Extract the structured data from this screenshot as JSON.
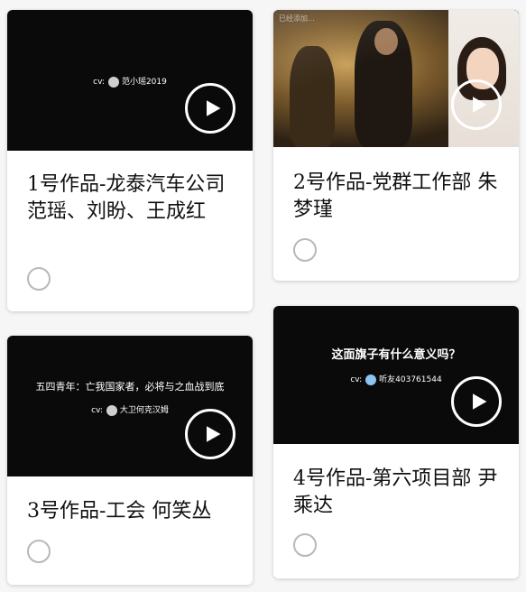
{
  "cards": [
    {
      "title": "1号作品-龙泰汽车公司 范瑶、刘盼、王成红",
      "thumb": {
        "cv_label": "cv:",
        "cv_name": "范小瑶2019"
      },
      "selected": false
    },
    {
      "title": "2号作品-党群工作部 朱梦瑾",
      "thumb": {
        "watermark": "已经添加..."
      },
      "selected": false
    },
    {
      "title": "3号作品-工会 何笑丛",
      "thumb": {
        "headline": "五四青年：亡我国家者，必将与之血战到底",
        "cv_label": "cv:",
        "cv_name": "大卫何克汉姆"
      },
      "selected": false
    },
    {
      "title": "4号作品-第六项目部 尹乘达",
      "thumb": {
        "headline": "这面旗子有什么意义吗？",
        "cv_label": "cv:",
        "cv_name": "听友403761544"
      },
      "selected": false
    }
  ],
  "icons": {
    "play": "play-icon",
    "radio": "radio-unchecked-icon",
    "avatar": "avatar-icon"
  },
  "colors": {
    "thumb_bg": "#0a0a0a",
    "card_bg": "#ffffff",
    "radio_border": "#b8b8b8",
    "title_text": "#111111"
  }
}
